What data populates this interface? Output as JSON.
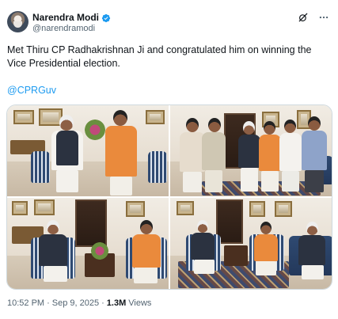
{
  "author": {
    "display_name": "Narendra Modi",
    "handle": "@narendramodi",
    "verified": true,
    "verified_color": "#1d9bf0"
  },
  "header_icons": [
    "grok-icon",
    "more-icon"
  ],
  "tweet": {
    "text": "Met Thiru CP Radhakrishnan Ji and congratulated him on winning the Vice Presidential election.",
    "link": "@CPRGuv",
    "link_color": "#1d9bf0"
  },
  "media": {
    "photo_count": 4
  },
  "meta": {
    "time": "10:52 PM",
    "separator": "·",
    "date": "Sep 9, 2025",
    "views_count": "1.3M",
    "views_label": "Views"
  }
}
